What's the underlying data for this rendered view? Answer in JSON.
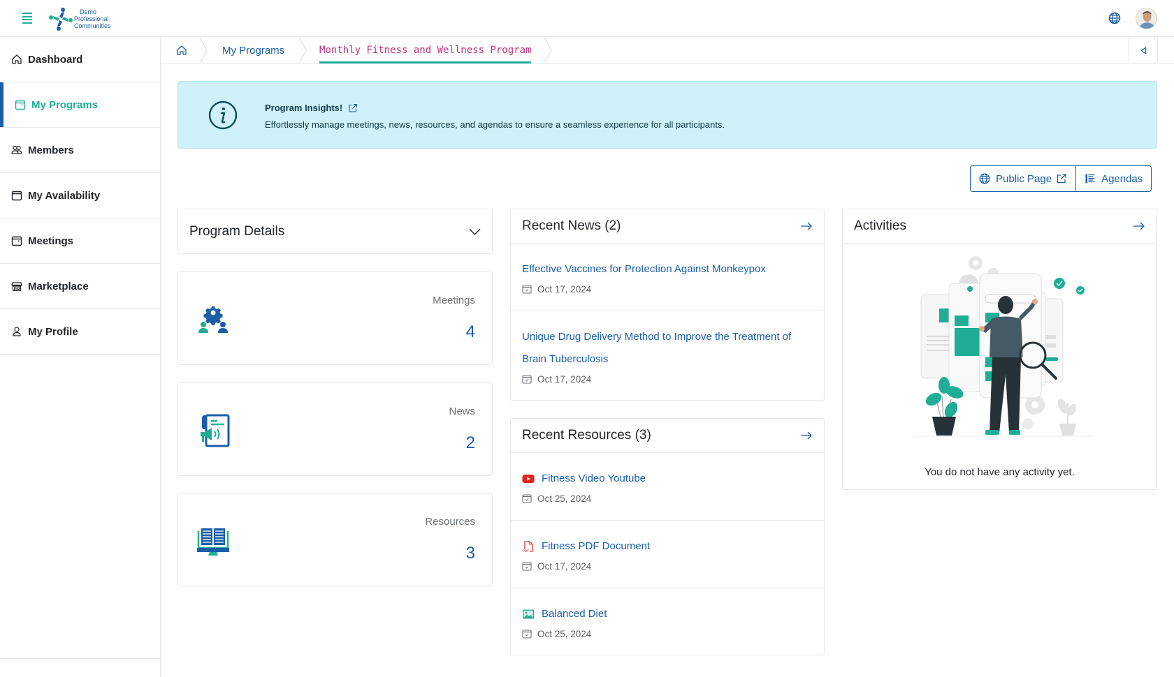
{
  "header": {
    "logo_lines": [
      "Demo",
      "Professional",
      "Communities"
    ],
    "menu_icon": "hamburger-icon",
    "language_icon": "globe-icon",
    "avatar_alt": "user-avatar"
  },
  "sidebar": {
    "items": [
      {
        "label": "Dashboard",
        "icon": "home-icon",
        "active": false
      },
      {
        "label": "My Programs",
        "icon": "calendar-icon",
        "active": true
      },
      {
        "label": "Members",
        "icon": "users-icon",
        "active": false
      },
      {
        "label": "My Availability",
        "icon": "calendar-icon",
        "active": false
      },
      {
        "label": "Meetings",
        "icon": "calendar-icon",
        "active": false
      },
      {
        "label": "Marketplace",
        "icon": "store-icon",
        "active": false
      },
      {
        "label": "My Profile",
        "icon": "user-icon",
        "active": false
      }
    ]
  },
  "breadcrumb": {
    "home_icon": "home-icon",
    "items": [
      "My Programs",
      "Monthly Fitness and Wellness Program"
    ],
    "collapse_icon": "triangle-left-icon"
  },
  "banner": {
    "title": "Program Insights!",
    "description": "Effortlessly manage meetings, news, resources, and agendas to ensure a seamless experience for all participants."
  },
  "actions": {
    "public_page": "Public Page",
    "agendas": "Agendas"
  },
  "program_details": {
    "title": "Program Details"
  },
  "stats": [
    {
      "label": "Meetings",
      "value": "4"
    },
    {
      "label": "News",
      "value": "2"
    },
    {
      "label": "Resources",
      "value": "3"
    }
  ],
  "recent_news": {
    "title": "Recent News (2)",
    "items": [
      {
        "title": "Effective Vaccines for Protection Against Monkeypox",
        "date": "Oct 17, 2024"
      },
      {
        "title": "Unique Drug Delivery Method to Improve the Treatment of Brain Tuberculosis",
        "date": "Oct 17, 2024"
      }
    ]
  },
  "recent_resources": {
    "title": "Recent Resources (3)",
    "items": [
      {
        "title": "Fitness Video Youtube",
        "type": "youtube-icon",
        "date": "Oct 25, 2024"
      },
      {
        "title": "Fitness PDF Document",
        "type": "pdf-icon",
        "date": "Oct 17, 2024"
      },
      {
        "title": "Balanced Diet",
        "type": "image-icon",
        "date": "Oct 25, 2024"
      }
    ]
  },
  "activities": {
    "title": "Activities",
    "empty_message": "You do not have any activity yet."
  },
  "colors": {
    "primary_blue": "#1a5ea8",
    "accent_teal": "#1fae95",
    "breadcrumb_current": "#c2307a",
    "banner_bg": "#cff1f9"
  }
}
